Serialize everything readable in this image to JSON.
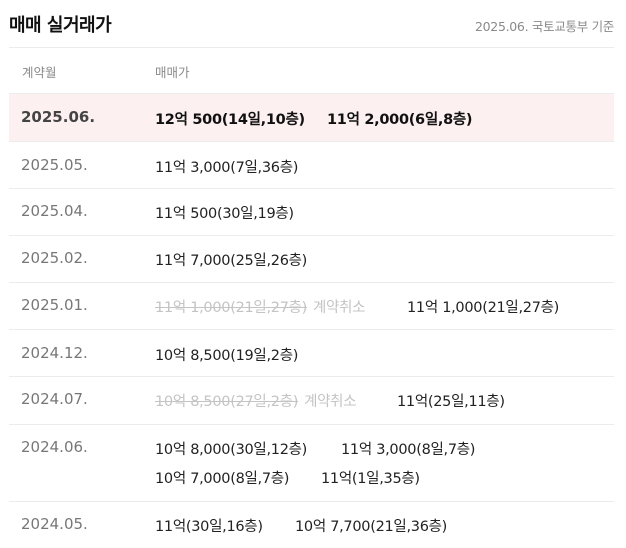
{
  "header": {
    "title": "매매 실거래가",
    "source": "2025.06. 국토교통부 기준"
  },
  "columns": {
    "month": "계약월",
    "price": "매매가"
  },
  "rows": [
    {
      "month": "2025.06.",
      "deals": [
        {
          "price": "12억 500(14일,10층)"
        },
        {
          "price": "11억 2,000(6일,8층)"
        }
      ]
    },
    {
      "month": "2025.05.",
      "deals": [
        {
          "price": "11억 3,000(7일,36층)"
        }
      ]
    },
    {
      "month": "2025.04.",
      "deals": [
        {
          "price": "11억 500(30일,19층)"
        }
      ]
    },
    {
      "month": "2025.02.",
      "deals": [
        {
          "price": "11억 7,000(25일,26층)"
        }
      ]
    },
    {
      "month": "2025.01.",
      "deals": [
        {
          "price": "11억 1,000(21일,27층)",
          "note": "계약취소"
        },
        {
          "price": "11억 1,000(21일,27층)"
        }
      ]
    },
    {
      "month": "2024.12.",
      "deals": [
        {
          "price": "10억 8,500(19일,2층)"
        }
      ]
    },
    {
      "month": "2024.07.",
      "deals": [
        {
          "price": "10억 8,500(27일,2층)",
          "note": "계약취소"
        },
        {
          "price": "11억(25일,11층)"
        }
      ]
    },
    {
      "month": "2024.06.",
      "deals": [
        {
          "price": "10억 8,000(30일,12층)"
        },
        {
          "price": "11억 3,000(8일,7층)"
        },
        {
          "price": "10억 7,000(8일,7층)"
        },
        {
          "price": "11억(1일,35층)"
        }
      ]
    },
    {
      "month": "2024.05.",
      "deals": [
        {
          "price": "11억(30일,16층)"
        },
        {
          "price": "10억 7,700(21일,36층)"
        }
      ]
    }
  ]
}
